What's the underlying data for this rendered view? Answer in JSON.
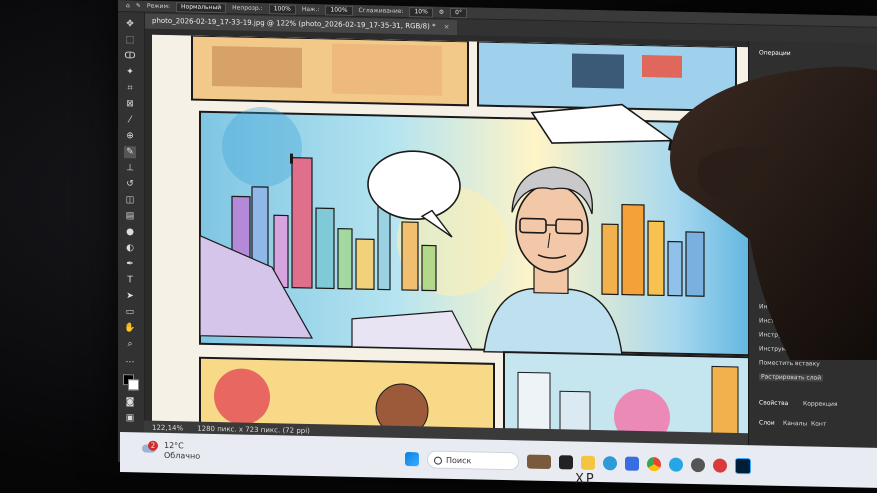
{
  "photoshop": {
    "options": {
      "mode_label": "Режим:",
      "mode_value": "Нормальный",
      "opacity_label": "Непрозр.:",
      "opacity_value": "100%",
      "flow_label": "Наж.:",
      "flow_value": "100%",
      "smoothing_label": "Сглаживание:",
      "smoothing_value": "10%",
      "angle_value": "0°"
    },
    "tab": {
      "title": "photo_2026-02-19_17-33-19.jpg @ 122% (photo_2026-02-19_17-35-31, RGB/8) *"
    },
    "status": {
      "zoom": "122,14%",
      "size": "1280 пикс. x 723 пикс. (72 ppi)"
    },
    "right_panel": {
      "header": "Операции",
      "history": [
        "Инструмент",
        "Инструмент \"Кисть\"",
        "Инструмент \"Кисть\"",
        "Инструмент \"Кисть\"",
        "Поместить вставку",
        "Растрировать слой"
      ],
      "properties_tab": "Свойства",
      "adjustments_tab": "Коррекция",
      "layers_tab": "Слои",
      "channels_tab": "Каналы",
      "paths_tab": "Конт"
    }
  },
  "taskbar": {
    "weather_temp": "12°C",
    "weather_desc": "Облачно",
    "notifications": "2",
    "search_placeholder": "Поиск"
  },
  "device_brand": "XP"
}
